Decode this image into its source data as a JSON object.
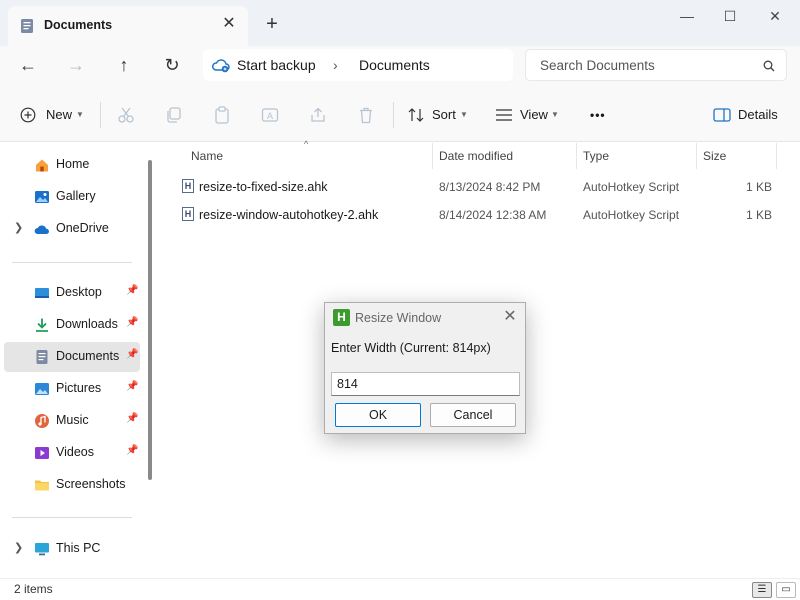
{
  "window": {
    "tab_title": "Documents",
    "tab_close": "✕",
    "new_tab": "+",
    "minimize": "—",
    "maximize": "☐",
    "close": "✕"
  },
  "nav": {
    "back": "←",
    "forward": "→",
    "up": "↑",
    "refresh": "↻",
    "address": {
      "backup": "Start backup",
      "separator": "›",
      "location": "Documents"
    },
    "search_placeholder": "Search Documents",
    "search_icon": "⌕"
  },
  "toolbar": {
    "new_label": "New",
    "sort_label": "Sort",
    "view_label": "View",
    "more": "•••",
    "details_label": "Details"
  },
  "sidebar": {
    "top": [
      {
        "label": "Home",
        "icon": "home-icon"
      },
      {
        "label": "Gallery",
        "icon": "gallery-icon"
      },
      {
        "label": "OneDrive",
        "icon": "cloud-icon"
      }
    ],
    "quick": [
      {
        "label": "Desktop",
        "icon": "desktop-icon",
        "pinned": true
      },
      {
        "label": "Downloads",
        "icon": "download-icon",
        "pinned": true
      },
      {
        "label": "Documents",
        "icon": "documents-icon",
        "pinned": true,
        "selected": true
      },
      {
        "label": "Pictures",
        "icon": "pictures-icon",
        "pinned": true
      },
      {
        "label": "Music",
        "icon": "music-icon",
        "pinned": true
      },
      {
        "label": "Videos",
        "icon": "videos-icon",
        "pinned": true
      },
      {
        "label": "Screenshots",
        "icon": "folder-icon",
        "pinned": false
      }
    ],
    "bottom": [
      {
        "label": "This PC",
        "icon": "pc-icon"
      }
    ]
  },
  "columns": [
    "Name",
    "Date modified",
    "Type",
    "Size"
  ],
  "files": [
    {
      "name": "resize-to-fixed-size.ahk",
      "date": "8/13/2024 8:42 PM",
      "type": "AutoHotkey Script",
      "size": "1 KB"
    },
    {
      "name": "resize-window-autohotkey-2.ahk",
      "date": "8/14/2024 12:38 AM",
      "type": "AutoHotkey Script",
      "size": "1 KB"
    }
  ],
  "status": {
    "count": "2 items"
  },
  "dialog": {
    "title": "Resize Window",
    "logo": "H",
    "prompt": "Enter Width (Current: 814px)",
    "value": "814",
    "ok": "OK",
    "cancel": "Cancel",
    "close": "✕"
  },
  "colors": {
    "accent": "#0078d4",
    "ahk_green": "#3d9a2e"
  }
}
